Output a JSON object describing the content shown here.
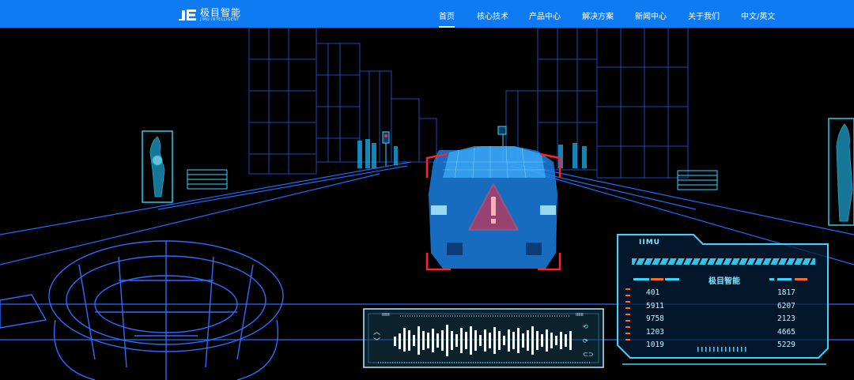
{
  "header": {
    "logo_mark": "JE",
    "brand_cn": "极目智能",
    "brand_en": "JIMU INTELLIGENT",
    "nav": [
      {
        "label": "首页",
        "active": true
      },
      {
        "label": "核心技术"
      },
      {
        "label": "产品中心"
      },
      {
        "label": "解决方案"
      },
      {
        "label": "新闻中心"
      },
      {
        "label": "关于我们"
      },
      {
        "label": "中文/英文"
      }
    ]
  },
  "hud": {
    "tag": "IIMU",
    "title": "极目智能",
    "left_values": [
      "401",
      "5911",
      "9758",
      "1203",
      "1019"
    ],
    "right_values": [
      "1817",
      "6207",
      "2123",
      "4665",
      "5229"
    ]
  },
  "wave": {
    "tag_left": "IIIIII",
    "tag_right": "IIIIII",
    "up_glyph": "︿",
    "down_glyph": "﹀",
    "icons": [
      "link-icon",
      "refresh-icon",
      "chain-icon"
    ]
  },
  "colors": {
    "nav_bg": "#0f7bf2",
    "wire_blue": "#1d6cff",
    "cyan": "#35d7ff",
    "alert_red": "#ff2030"
  }
}
